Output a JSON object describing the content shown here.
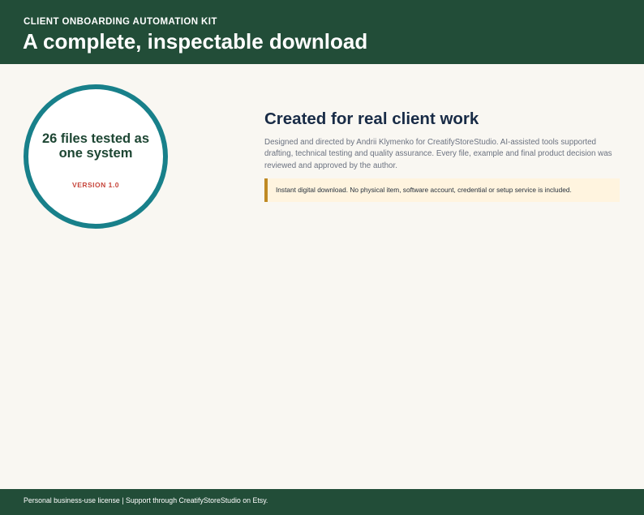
{
  "header": {
    "kicker": "CLIENT ONBOARDING AUTOMATION KIT",
    "title": "A complete, inspectable download"
  },
  "badge": {
    "text": "26 files tested as one system",
    "version": "VERSION 1.0"
  },
  "content": {
    "title": "Created for real client work",
    "body": "Designed and directed by Andrii Klymenko for CreatifyStoreStudio. AI-assisted tools supported drafting, technical testing and quality assurance. Every file, example and final product decision was reviewed and approved by the author."
  },
  "notice": {
    "text": "Instant digital download. No physical item, software account, credential or setup service is included."
  },
  "footer": {
    "text": "Personal business-use license | Support through CreatifyStoreStudio on Etsy."
  },
  "colors": {
    "header_background": "#224d38",
    "badge_ring": "#18808a",
    "badge_text": "#1d4633",
    "version_text": "#c7463c",
    "notice_background": "#fff4df",
    "notice_border": "#bf8a24"
  }
}
